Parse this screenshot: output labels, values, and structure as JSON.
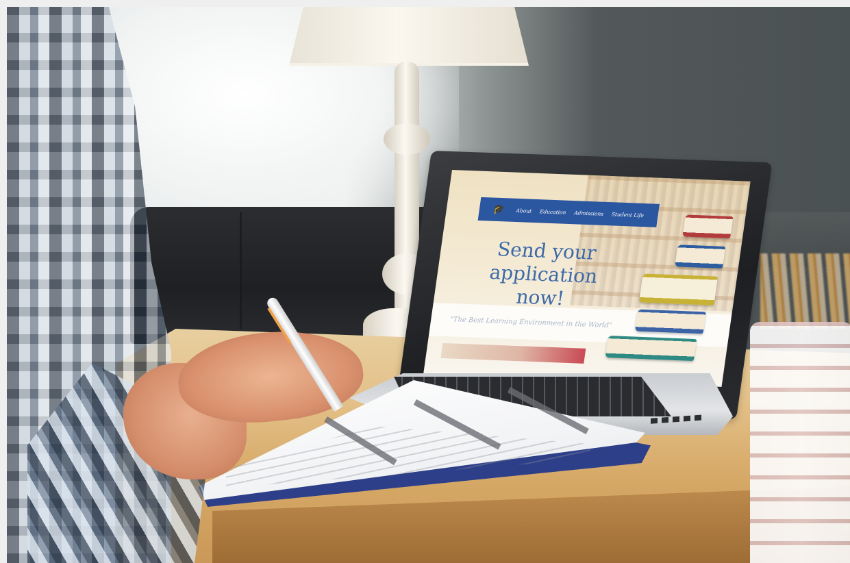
{
  "scene": {
    "description_label": "stock-photo",
    "colors": {
      "nav_bar": "#2b56a0",
      "headline": "#3d6aa8",
      "tagline": "#a7b5c9",
      "desk_wood": "#e3c088",
      "clipboard": "#2e3f8a"
    }
  },
  "laptop_screen": {
    "nav": {
      "logo_icon": "graduation-cap-icon",
      "items": [
        "About",
        "Education",
        "Admissions",
        "Student Life"
      ]
    },
    "headline_line1": "Send your",
    "headline_line2": "application now!",
    "tagline": "\"The Best Learning Environment in the World\""
  }
}
